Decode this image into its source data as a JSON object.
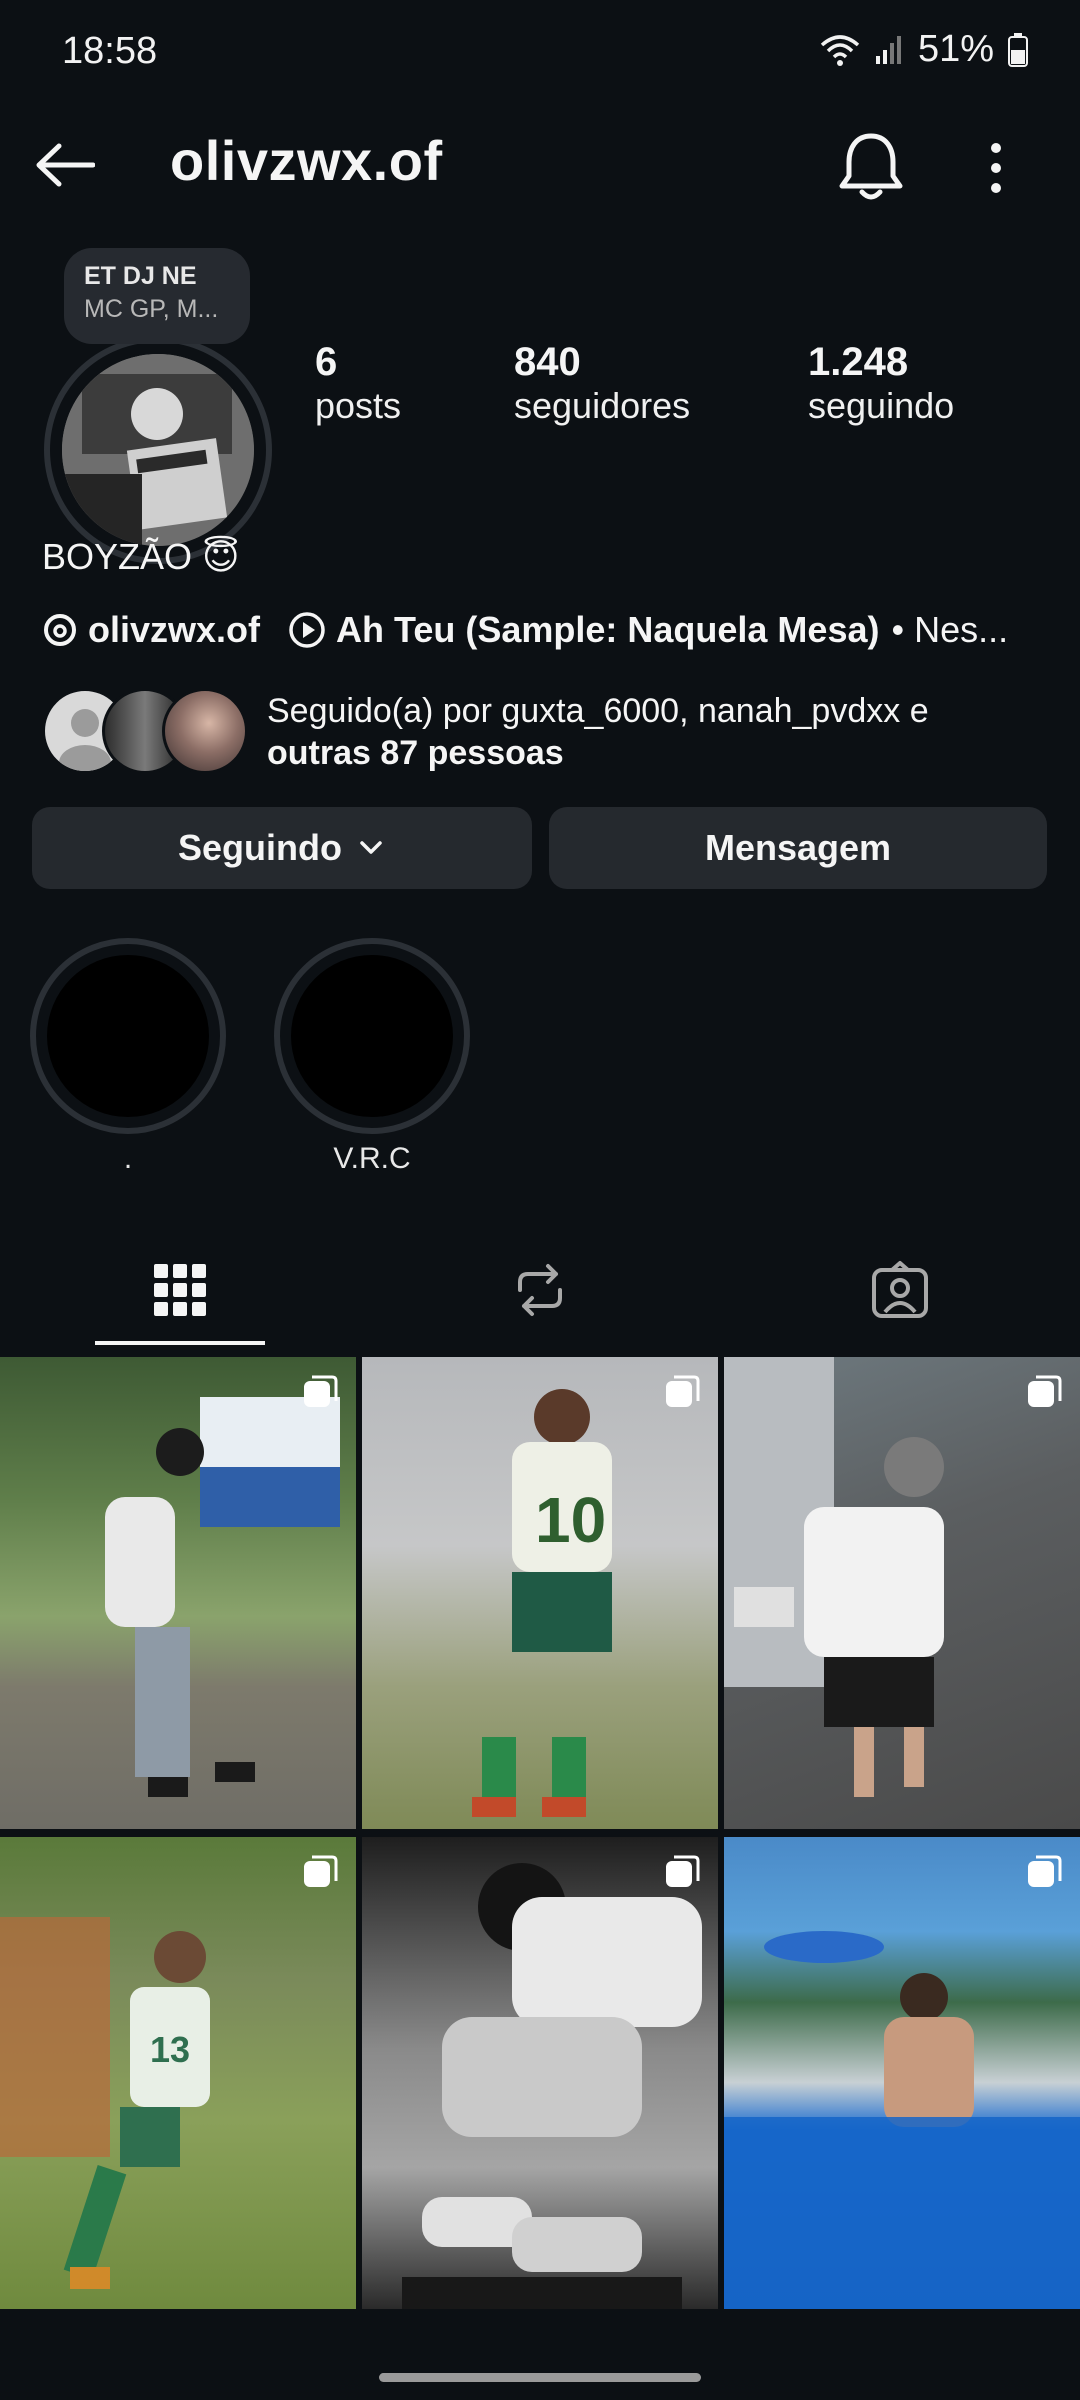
{
  "status_bar": {
    "time": "18:58",
    "battery": "51%"
  },
  "header": {
    "username": "olivzwx.of"
  },
  "note": {
    "line1": "ET DJ NE",
    "line2": "MC GP, M..."
  },
  "stats": [
    {
      "value": "6",
      "label": "posts"
    },
    {
      "value": "840",
      "label": "seguidores"
    },
    {
      "value": "1.248",
      "label": "seguindo"
    }
  ],
  "bio": "BOYZÃO 😇",
  "links": {
    "threads_handle": "olivzwx.of",
    "music": "Ah Teu (Sample: Naquela Mesa)",
    "music_suffix": "• Nes..."
  },
  "followed_by": {
    "prefix": "Seguido(a) por guxta_6000, nanah_pvdxx e",
    "suffix": "outras 87 pessoas"
  },
  "buttons": {
    "following": "Seguindo",
    "message": "Mensagem"
  },
  "highlights": [
    {
      "label": "."
    },
    {
      "label": "V.R.C"
    }
  ],
  "tabs": [
    "grid-icon",
    "reposts-icon",
    "tagged-icon"
  ],
  "colors": {
    "background": "#0c1014",
    "button": "#25292e",
    "text": "#f5f5f5"
  }
}
